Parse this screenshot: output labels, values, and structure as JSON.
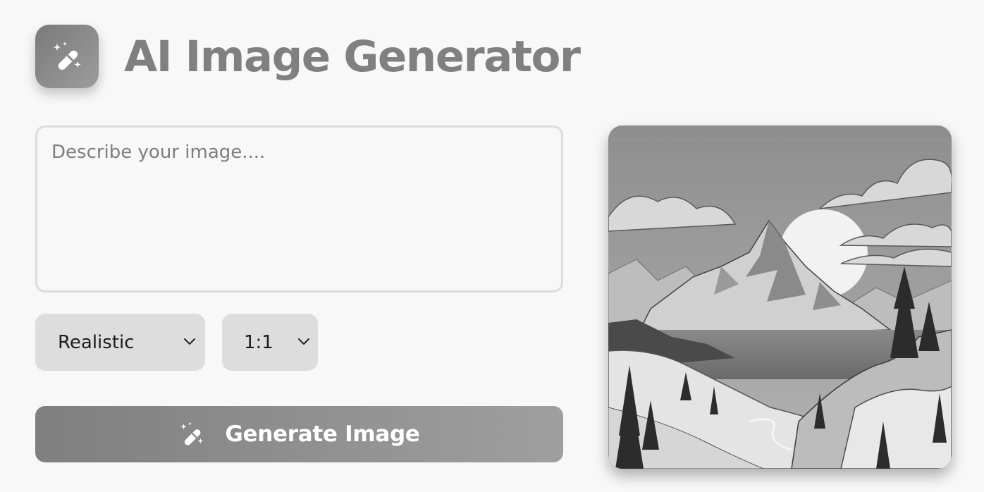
{
  "header": {
    "logo_icon": "magic-wand-icon",
    "title": "AI Image Generator"
  },
  "prompt": {
    "placeholder": "Describe your image....",
    "value": ""
  },
  "controls": {
    "style_select": {
      "selected": "Realistic",
      "icon": "chevron-down-icon"
    },
    "ratio_select": {
      "selected": "1:1",
      "icon": "chevron-down-icon"
    }
  },
  "generate_button": {
    "label": "Generate Image",
    "icon": "magic-wand-icon"
  },
  "preview": {
    "icon": "mountain-landscape-image"
  },
  "colors": {
    "background": "#f8f8f8",
    "accent": "#8c8c8c",
    "title": "#808080",
    "select_bg": "#dddddd"
  }
}
